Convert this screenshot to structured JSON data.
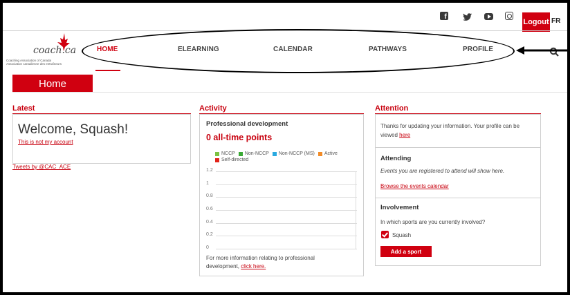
{
  "header": {
    "social_icons": [
      "facebook-icon",
      "twitter-icon",
      "youtube-icon",
      "instagram-icon"
    ],
    "logout_label": "Logout",
    "lang_label": "FR"
  },
  "logo": {
    "word": "coach.ca",
    "line1": "Coaching Association of Canada",
    "line2": "Association canadienne des entraîneurs"
  },
  "nav": {
    "items": [
      "HOME",
      "ELEARNING",
      "CALENDAR",
      "PATHWAYS",
      "PROFILE"
    ],
    "active_index": 0
  },
  "page_banner": "Home",
  "latest": {
    "title": "Latest",
    "welcome": "Welcome, Squash!",
    "not_me": "This is not my account",
    "tweets": "Tweets by @CAC_ACE"
  },
  "activity": {
    "title": "Activity",
    "pd_heading": "Professional development",
    "points": "0 all-time points",
    "footer_text_1": "For more information relating to professional",
    "footer_text_2": "development,",
    "footer_link": "click here."
  },
  "chart_data": {
    "type": "bar",
    "series": [
      {
        "name": "NCCP",
        "values": []
      },
      {
        "name": "Non-NCCP",
        "values": []
      },
      {
        "name": "Non-NCCP (MS)",
        "values": []
      },
      {
        "name": "Active",
        "values": []
      },
      {
        "name": "Self-directed",
        "values": []
      }
    ],
    "series_colors": [
      "#7cc242",
      "#3aa935",
      "#29a9e0",
      "#f28c28",
      "#e2231a"
    ],
    "yticks": [
      "1.2",
      "1",
      "0.8",
      "0.6",
      "0.4",
      "0.2",
      "0"
    ],
    "ylim": [
      0,
      1.2
    ],
    "grid": true,
    "legend_position": "top"
  },
  "attention": {
    "title": "Attention",
    "text_1": "Thanks for updating your information. Your profile can be",
    "text_2": "viewed",
    "link": "here",
    "attending_heading": "Attending",
    "attending_text": "Events you are registered to attend will show here.",
    "browse_link": "Browse the events calendar",
    "involvement_heading": "Involvement",
    "involvement_question": "In which sports are you currently involved?",
    "sport": "Squash",
    "add_sport": "Add a sport"
  }
}
